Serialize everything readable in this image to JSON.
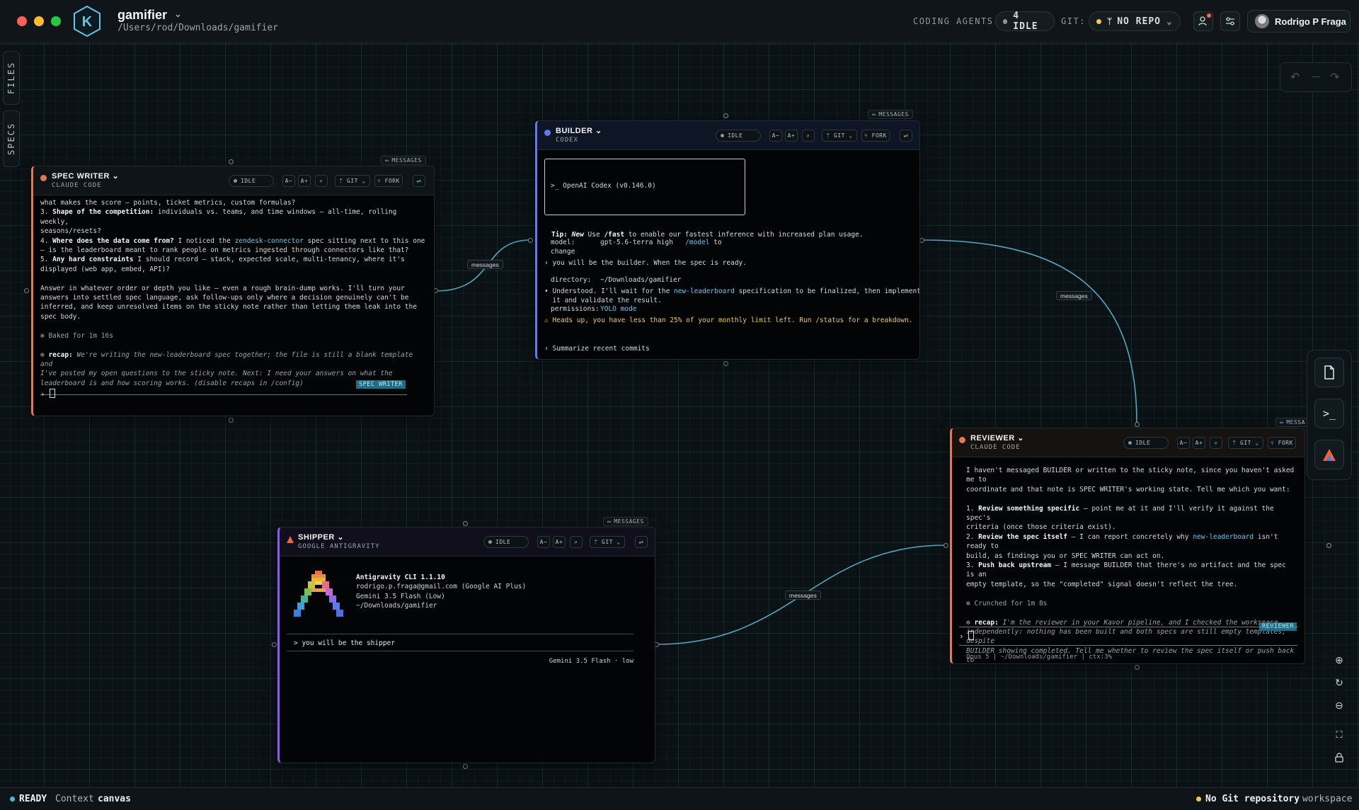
{
  "window": {
    "project_name": "gamifier",
    "project_path": "/Users/rod/Downloads/gamifier"
  },
  "topbar": {
    "coding_agents_label": "CODING AGENTS:",
    "agents_status": "4 IDLE",
    "git_label": "GIT:",
    "git_status": "NO REPO",
    "user_name": "Rodrigo P Fraga"
  },
  "rail": {
    "files_label": "FILES",
    "specs_label": "SPECS"
  },
  "common": {
    "idle": "IDLE",
    "font_down": "A−",
    "font_up": "A+",
    "git": "GIT",
    "fork": "FORK",
    "messages": "MESSAGES",
    "edge_messages": "messages"
  },
  "spec_writer": {
    "title": "SPEC WRITER",
    "subtitle": "CLAUDE CODE",
    "line1": "what makes the score — points, ticket metrics, custom formulas?",
    "item3_num": "3. ",
    "item3_bold": "Shape of the competition:",
    "item3_text": " individuals vs. teams, and time windows — all-time, rolling weekly,\nseasons/resets?",
    "item4_num": "4. ",
    "item4_bold": "Where does the data come from?",
    "item4_text_a": " I noticed the ",
    "item4_link": "zendesk-connector",
    "item4_text_b": " spec sitting next to this one\n— is the leaderboard meant to rank people on metrics ingested through connectors like that?",
    "item5_num": "5. ",
    "item5_bold": "Any hard constraints",
    "item5_text": " I should record — stack, expected scale, multi-tenancy, where it's\ndisplayed (web app, embed, API)?",
    "para": "Answer in whatever order or depth you like — even a rough brain-dump works. I'll turn your\nanswers into settled spec language, ask follow-ups only where a decision genuinely can't be\ninferred, and keep unresolved items on the sticky note rather than letting them leak into the\nspec body.",
    "baked": "Baked for 1m 16s",
    "recap_label": "recap:",
    "recap_text": " We're writing the new-leaderboard spec together; the file is still a blank template and\nI've posted my open questions to the sticky note. Next: I need your answers on what the\nleaderboard is and how scoring works. (disable recaps in /config)",
    "badge": "SPEC WRITER",
    "prompt": "›"
  },
  "builder": {
    "title": "BUILDER",
    "subtitle": "CODEX",
    "box_title": ">_ OpenAI Codex (v0.146.0)",
    "model_label": "model:",
    "model_value": "gpt-5.6-terra high",
    "model_cmd": "/model",
    "model_cmd_text": "to change",
    "dir_label": "directory:",
    "dir_value": "~/Downloads/gamifier",
    "perm_label": "permissions:",
    "perm_value": "YOLO mode",
    "tip_label": "Tip:",
    "tip_new": "New",
    "tip_text_a": "Use",
    "tip_cmd": "/fast",
    "tip_text_b": "to enable our fastest inference with increased plan usage.",
    "user_msg": "› you will be the builder. When the spec is ready.",
    "reply_a": "• Understood. I'll wait for the ",
    "reply_link": "new-leaderboard",
    "reply_b": " specification to be finalized, then implement\n  it and validate the result.",
    "warning": "⚠ Heads up, you have less than 25% of your monthly limit left. Run /status for a breakdown.",
    "suggest": "› Summarize recent commits"
  },
  "reviewer": {
    "title": "REVIEWER",
    "subtitle": "CLAUDE CODE",
    "intro": "I haven't messaged BUILDER or written to the sticky note, since you haven't asked me to\ncoordinate and that note is SPEC WRITER's working state. Tell me which you want:",
    "o1_num": "1. ",
    "o1_bold": "Review something specific",
    "o1_text": " — point me at it and I'll verify it against the spec's\ncriteria (once those criteria exist).",
    "o2_num": "2. ",
    "o2_bold": "Review the spec itself",
    "o2_text_a": " — I can report concretely why ",
    "o2_link": "new-leaderboard",
    "o2_text_b": " isn't ready to\nbuild, as findings you or SPEC WRITER can act on.",
    "o3_num": "3. ",
    "o3_bold": "Push back upstream",
    "o3_text": " — I message BUILDER that there's no artifact and the spec is an\nempty template, so the \"completed\" signal doesn't reflect the tree.",
    "crunched": "Crunched for 1m 8s",
    "recap_label": "recap:",
    "recap_text": " I'm the reviewer in your Kavor pipeline, and I checked the workspace\nindependently: nothing has been built and both specs are still empty templates, despite\nBUILDER showing completed. Tell me whether to review the spec itself or push back to\nBUILDER. (disable recaps in /config)",
    "badge": "REVIEWER",
    "prompt": "›",
    "footer": "Opus 5 | ~/Downloads/gamifier | ctx:3%",
    "msg_tag": "MESSA"
  },
  "shipper": {
    "title": "SHIPPER",
    "subtitle": "GOOGLE ANTIGRAVITY",
    "cli_name": "Antigravity CLI 1.1.10",
    "account": "rodrigo.p.fraga@gmail.com (Google AI Plus)",
    "model": "Gemini 3.5 Flash (Low)",
    "path": "~/Downloads/gamifier",
    "user_msg": "> you will be the shipper",
    "footer": "Gemini 3.5 Flash · low"
  },
  "statusbar": {
    "ready": "READY",
    "context_label": "Context",
    "context_value": "canvas",
    "git_msg": "No Git repository",
    "git_scope": "workspace"
  },
  "colors": {
    "accent": "#5ec6e8",
    "edge": "#62c3df",
    "claude_orange": "#e07b4f",
    "codex_blue": "#5b7bf0",
    "idle_gray": "#8b969c",
    "ready_green": "#3fbfe0",
    "warn_yellow": "#f2c94c"
  }
}
